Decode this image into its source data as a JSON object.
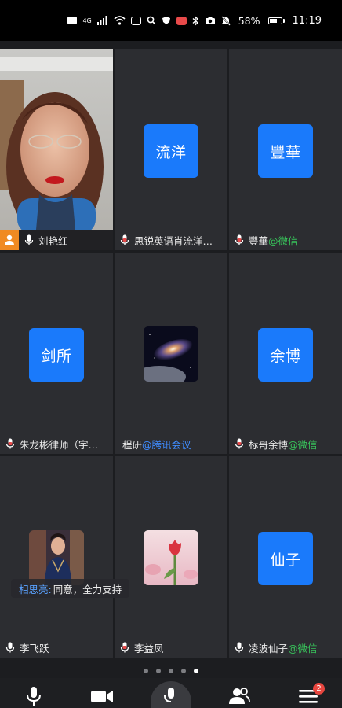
{
  "status_bar": {
    "battery": "58%",
    "time": "11:19",
    "network": "4G",
    "indicators": [
      "hd-icon",
      "signal-icon",
      "wifi-icon",
      "notification-icon",
      "bluetooth-icon",
      "camera-icon",
      "mute-icon"
    ]
  },
  "participants": [
    {
      "name": "刘艳红",
      "tag": "",
      "kind": "video",
      "host": true,
      "mic": "active"
    },
    {
      "name": "思锐英语肖流洋…",
      "tag": "",
      "kind": "avatar",
      "avatar_text": "流洋",
      "mic": "muted"
    },
    {
      "name": "豐華",
      "tag": "@微信",
      "tag_color": "green",
      "kind": "avatar",
      "avatar_text": "豐華",
      "mic": "muted"
    },
    {
      "name": "朱龙彬律师（宇…",
      "tag": "",
      "kind": "avatar",
      "avatar_text": "剑所",
      "mic": "muted"
    },
    {
      "name": "程研",
      "tag": "@腾讯会议",
      "tag_color": "blue",
      "kind": "image",
      "image": "galaxy",
      "mic": "none"
    },
    {
      "name": "标哥余博",
      "tag": "@微信",
      "tag_color": "green",
      "kind": "avatar",
      "avatar_text": "余博",
      "mic": "muted"
    },
    {
      "name": "李飞跃",
      "tag": "",
      "kind": "image",
      "image": "portrait",
      "mic": "active"
    },
    {
      "name": "李益凤",
      "tag": "",
      "kind": "image",
      "image": "tulip",
      "mic": "muted"
    },
    {
      "name": "凌波仙子",
      "tag": "@微信",
      "tag_color": "green",
      "kind": "avatar",
      "avatar_text": "仙子",
      "mic": "active"
    }
  ],
  "chat": {
    "sender": "相思亮:",
    "message": "同意，全力支持"
  },
  "pager": {
    "pages": 5,
    "current": 5
  },
  "toolbar": {
    "items": [
      "mic-icon",
      "video-camera-icon",
      "share-icon",
      "participants-icon",
      "menu-icon"
    ],
    "menu_badge": "2"
  },
  "colors": {
    "avatar_blue": "#1a7afb",
    "tile_bg": "#2c2d31",
    "host_orange": "#f08a22",
    "tag_blue": "#3f8cff",
    "tag_green": "#38c15a",
    "badge_red": "#e8463f"
  }
}
